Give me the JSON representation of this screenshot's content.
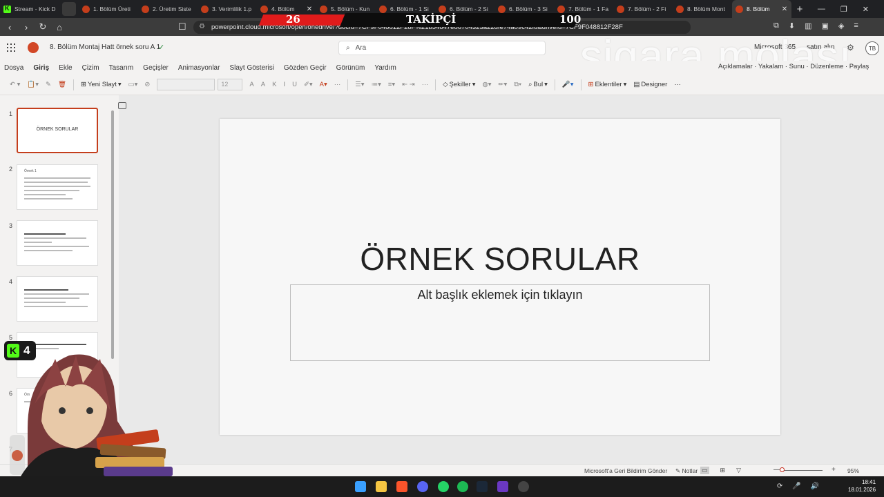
{
  "browser": {
    "tabs": [
      {
        "title": "Stream - Kick D",
        "icon": "kick-icon",
        "active": false
      },
      {
        "title": "1. Bölüm Üreti",
        "icon": "powerpoint-icon",
        "active": false
      },
      {
        "title": "2. Üretim Siste",
        "icon": "powerpoint-icon",
        "active": false
      },
      {
        "title": "3. Verimlilik 1.p",
        "icon": "powerpoint-icon",
        "active": false
      },
      {
        "title": "4. Bölüm",
        "icon": "powerpoint-icon",
        "active": false
      },
      {
        "title": "5. Bölüm - Kun",
        "icon": "powerpoint-icon",
        "active": false
      },
      {
        "title": "6. Bölüm - 1 Si",
        "icon": "powerpoint-icon",
        "active": false
      },
      {
        "title": "6. Bölüm - 2 Si",
        "icon": "powerpoint-icon",
        "active": false
      },
      {
        "title": "6. Bölüm - 3 Si",
        "icon": "powerpoint-icon",
        "active": false
      },
      {
        "title": "7. Bölüm - 1 Fa",
        "icon": "powerpoint-icon",
        "active": false
      },
      {
        "title": "7. Bölüm - 2 Fi",
        "icon": "powerpoint-icon",
        "active": false
      },
      {
        "title": "8. Bölüm Mont",
        "icon": "powerpoint-icon",
        "active": false
      },
      {
        "title": "8. Bölüm",
        "icon": "powerpoint-icon",
        "active": true
      }
    ],
    "url": "powerpoint.cloud.microsoft/open/onedrive/?docId=7CF9F048812F28F%21b54847e86704323a22dfe74a09c42fd&driveId=7CF9F048812F28F"
  },
  "stream_overlay": {
    "count_left": "26",
    "label": "TAKİPÇİ",
    "count_right": "100",
    "watermark": "sigara molası",
    "kick_badge": "4"
  },
  "office": {
    "doc_title": "8. Bölüm Montaj Hatt örnek soru A 1",
    "search_placeholder": "Ara",
    "m365_label": "Microsoft 365",
    "buy_label": "satın alın",
    "avatar_initials": "TB",
    "menu": [
      "Dosya",
      "Giriş",
      "Ekle",
      "Çizim",
      "Tasarım",
      "Geçişler",
      "Animasyonlar",
      "Slayt Gösterisi",
      "Gözden Geçir",
      "Görünüm",
      "Yardım"
    ],
    "menu_selected": "Giriş",
    "menu_right": "Açıklamalar · Yakalam · Sunu · Düzenleme · Paylaş",
    "ribbon": {
      "new_slide": "Yeni Slayt",
      "font_size": "12",
      "shapes": "Şekiller",
      "find": "Bul",
      "addins": "Eklentiler",
      "designer": "Designer"
    }
  },
  "slides": [
    {
      "num": "1",
      "title": "ÖRNEK SORULAR",
      "selected": true
    },
    {
      "num": "2",
      "title": "Örnek 1",
      "selected": false
    },
    {
      "num": "3",
      "title": "",
      "selected": false
    },
    {
      "num": "4",
      "title": "",
      "selected": false
    },
    {
      "num": "5",
      "title": "",
      "selected": false
    },
    {
      "num": "6",
      "title": "Örn",
      "selected": false
    },
    {
      "num": "7",
      "title": "",
      "selected": false
    }
  ],
  "current_slide": {
    "title": "ÖRNEK SORULAR",
    "subtitle_placeholder": "Alt başlık eklemek için tıklayın"
  },
  "statusbar": {
    "feedback": "Microsoft'a Geri Bildirim Gönder",
    "notes": "Notlar",
    "zoom": "95%"
  },
  "taskbar": {
    "time": "18:41",
    "date": "18.01.2026"
  },
  "colors": {
    "accent": "#c43e1c",
    "kick_green": "#53fc18"
  }
}
